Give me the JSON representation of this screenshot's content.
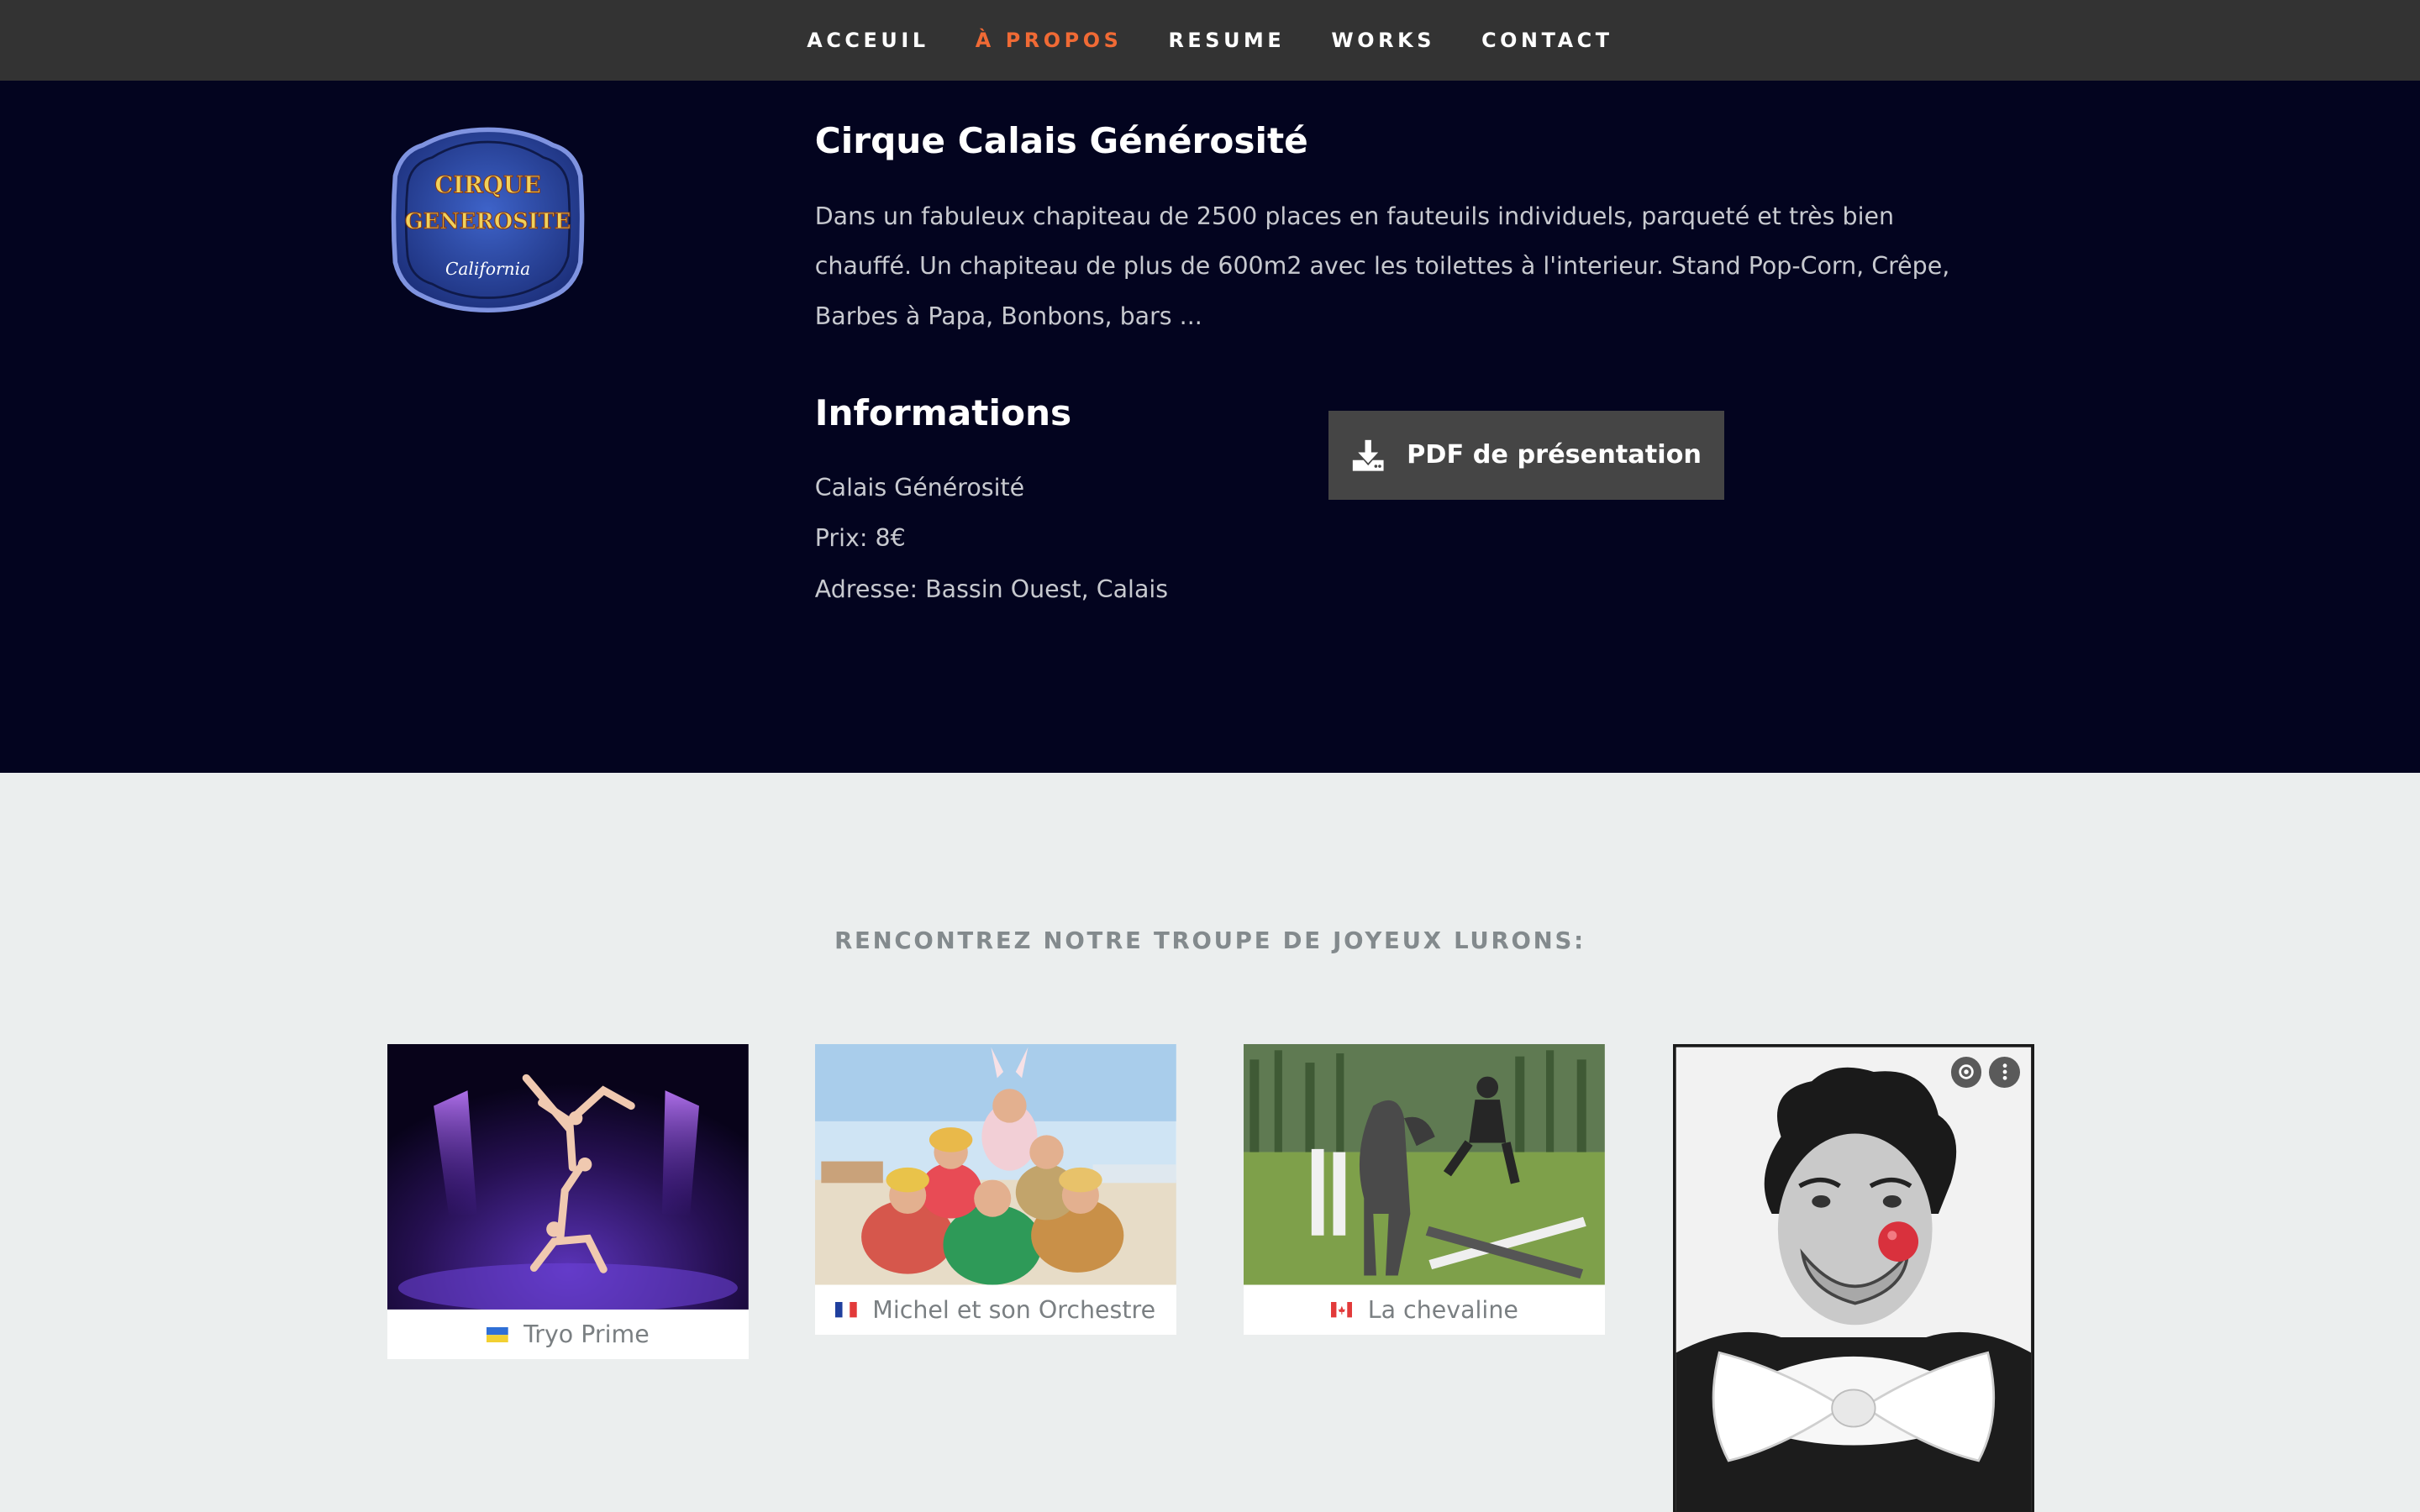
{
  "nav": {
    "items": [
      {
        "label": "ACCEUIL",
        "active": false
      },
      {
        "label": "À PROPOS",
        "active": true
      },
      {
        "label": "RESUME",
        "active": false
      },
      {
        "label": "WORKS",
        "active": false
      },
      {
        "label": "CONTACT",
        "active": false
      }
    ],
    "active_color": "#f06a35"
  },
  "about": {
    "logo_text": {
      "line1": "CIRQUE",
      "line2": "GENEROSITE",
      "line3": "California"
    },
    "title": "Cirque Calais Générosité",
    "description": "Dans un fabuleux chapiteau de 2500 places en fauteuils individuels, parqueté et très bien chauffé. Un chapiteau de plus de 600m2 avec les toilettes à l'interieur. Stand Pop-Corn, Crêpe, Barbes à Papa, Bonbons, bars ...",
    "info_title": "Informations",
    "info": [
      "Calais Générosité",
      "Prix: 8€",
      "Adresse: Bassin Ouest, Calais"
    ],
    "pdf_button": {
      "label": "PDF de présentation",
      "icon": "download-icon"
    }
  },
  "troupe": {
    "title": "RENCONTREZ NOTRE TROUPE DE JOYEUX LURONS:",
    "members": [
      {
        "name": "Tryo Prime",
        "flag": "ukraine-flag-icon"
      },
      {
        "name": "Michel et son Orchestre",
        "flag": "france-flag-icon"
      },
      {
        "name": "La chevaline",
        "flag": "canada-flag-icon"
      }
    ]
  },
  "colors": {
    "nav_bg": "#333333",
    "hero_bg": "#03041f",
    "section_bg": "#ebeeee",
    "button_bg": "#454545"
  }
}
